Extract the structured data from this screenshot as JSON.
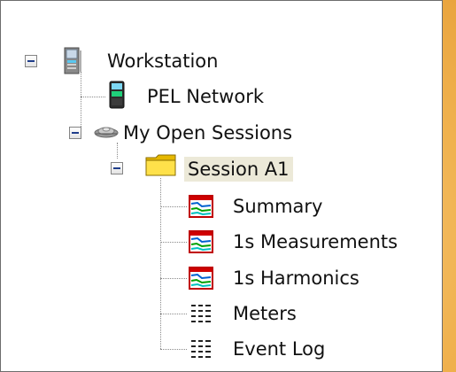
{
  "tree": {
    "workstation": {
      "label": "Workstation",
      "icon": "workstation-icon",
      "expanded": true
    },
    "pel_network": {
      "label": "PEL Network",
      "icon": "pel-device-icon"
    },
    "my_open_sessions": {
      "label": "My Open Sessions",
      "icon": "network-sessions-icon",
      "expanded": true
    },
    "session_a1": {
      "label": "Session A1",
      "icon": "folder-icon",
      "expanded": true,
      "selected": true,
      "children": [
        {
          "label": "Summary",
          "icon": "chart-icon"
        },
        {
          "label": "1s Measurements",
          "icon": "chart-icon"
        },
        {
          "label": "1s Harmonics",
          "icon": "chart-icon"
        },
        {
          "label": "Meters",
          "icon": "grid-icon"
        },
        {
          "label": "Event Log",
          "icon": "grid-icon"
        }
      ]
    }
  },
  "colors": {
    "background_orange": "#f6c97a",
    "panel_white": "#ffffff",
    "selection_bg": "#ece9d8",
    "folder_yellow": "#ffe14a",
    "toggle_blue": "#1f3d8a"
  }
}
